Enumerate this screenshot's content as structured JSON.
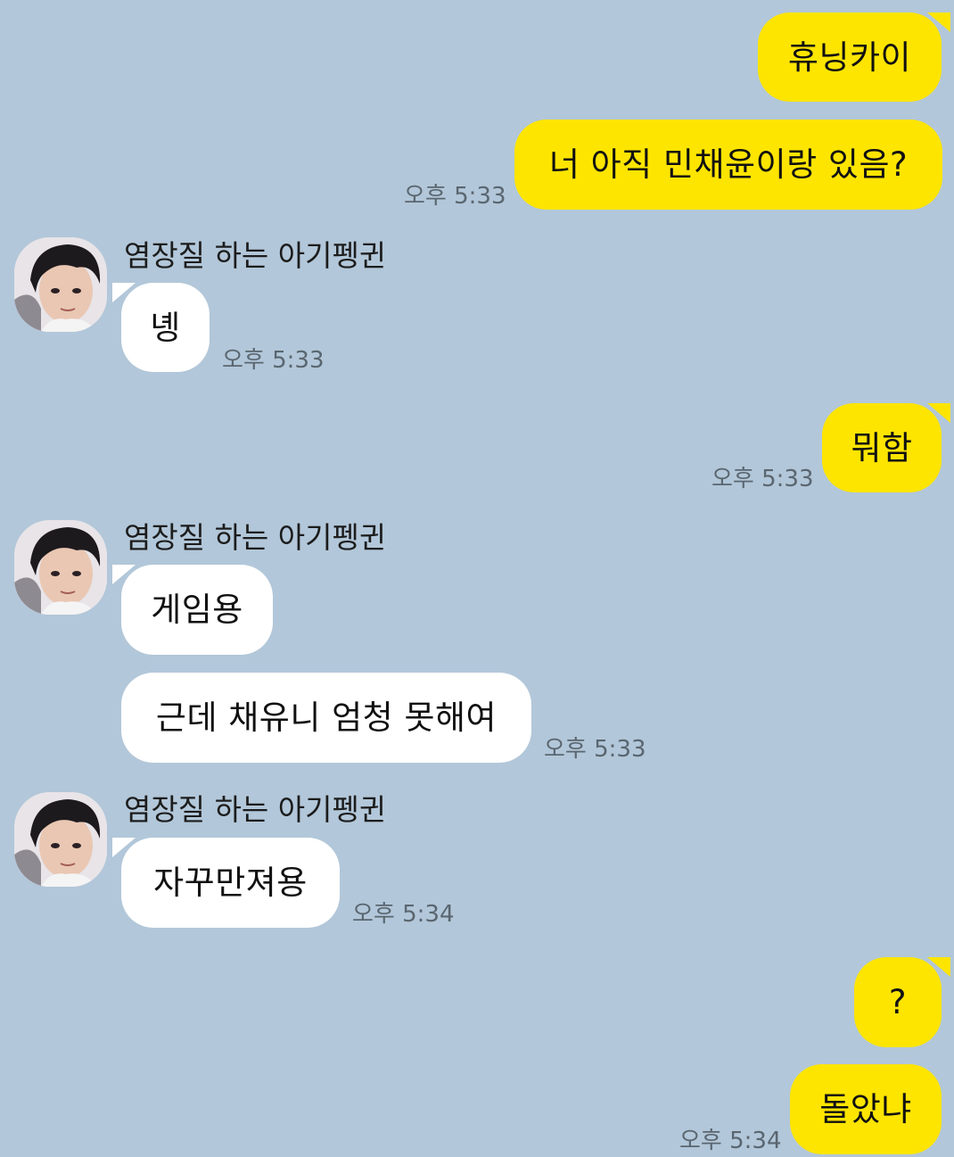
{
  "colors": {
    "background": "#b2c7d9",
    "my_bubble": "#fee500",
    "their_bubble": "#ffffff",
    "timestamp": "#5a6670"
  },
  "contact": {
    "name": "염장질 하는 아기펭귄",
    "avatar_icon": "profile-photo"
  },
  "messages": [
    {
      "from": "me",
      "text": "휴닝카이"
    },
    {
      "from": "me",
      "text": "너 아직 민채윤이랑 있음?",
      "time": "오후 5:33"
    },
    {
      "from": "them",
      "sender": "염장질 하는 아기펭귄",
      "text": "녱",
      "time": "오후 5:33"
    },
    {
      "from": "me",
      "text": "뭐함",
      "time": "오후 5:33"
    },
    {
      "from": "them",
      "sender": "염장질 하는 아기펭귄",
      "text": "게임용"
    },
    {
      "from": "them",
      "text": "근데 채유니 엄청 못해여",
      "time": "오후 5:33"
    },
    {
      "from": "them",
      "sender": "염장질 하는 아기펭귄",
      "text": "자꾸만져용",
      "time": "오후 5:34"
    },
    {
      "from": "me",
      "text": "?"
    },
    {
      "from": "me",
      "text": "돌았냐",
      "time": "오후 5:34"
    }
  ]
}
